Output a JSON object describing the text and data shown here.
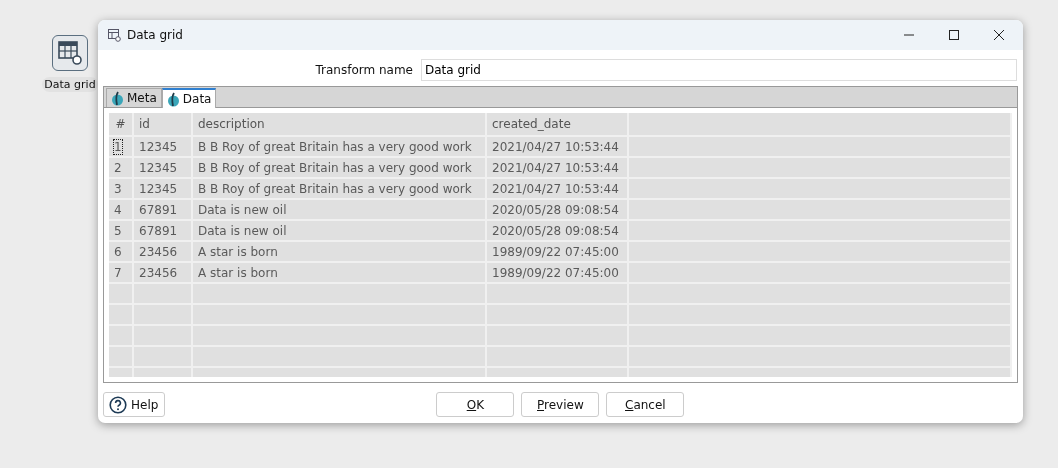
{
  "canvas_node": {
    "label": "Data grid"
  },
  "window": {
    "title": "Data grid"
  },
  "transform_name": {
    "label": "Transform name",
    "value": "Data grid"
  },
  "tabs": [
    {
      "label": "Meta",
      "selected": false
    },
    {
      "label": "Data",
      "selected": true
    }
  ],
  "table": {
    "columns": [
      "#",
      "id",
      "description",
      "created_date"
    ],
    "rows": [
      {
        "cells": [
          "1",
          "12345",
          "B B Roy of great Britain has a very good work",
          "2021/04/27 10:53:44"
        ],
        "focused": true
      },
      {
        "cells": [
          "2",
          "12345",
          "B B Roy of great Britain has a very good work",
          "2021/04/27 10:53:44"
        ],
        "focused": false
      },
      {
        "cells": [
          "3",
          "12345",
          "B B Roy of great Britain has a very good work",
          "2021/04/27 10:53:44"
        ],
        "focused": false
      },
      {
        "cells": [
          "4",
          "67891",
          "Data is new oil",
          "2020/05/28 09:08:54"
        ],
        "focused": false
      },
      {
        "cells": [
          "5",
          "67891",
          "Data is new oil",
          "2020/05/28 09:08:54"
        ],
        "focused": false
      },
      {
        "cells": [
          "6",
          "23456",
          "A star is born",
          "1989/09/22 07:45:00"
        ],
        "focused": false
      },
      {
        "cells": [
          "7",
          "23456",
          "A star is born",
          "1989/09/22 07:45:00"
        ],
        "focused": false
      }
    ]
  },
  "help_button": {
    "label": "Help"
  },
  "buttons": [
    {
      "accel": "O",
      "rest": "K"
    },
    {
      "accel": "P",
      "rest": "review"
    },
    {
      "accel": "C",
      "rest": "ancel"
    }
  ]
}
